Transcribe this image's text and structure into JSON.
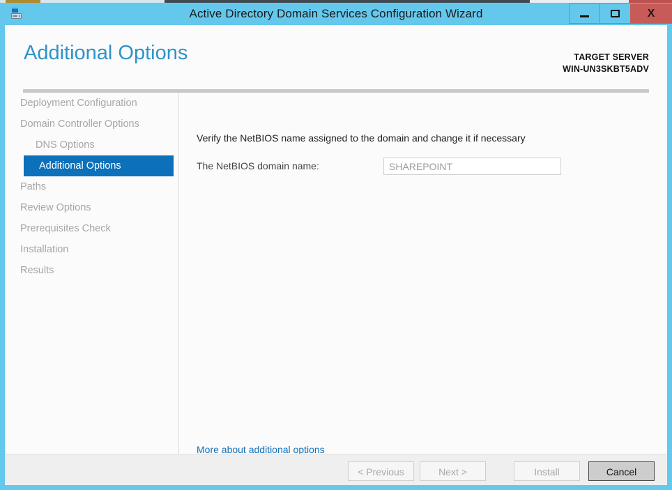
{
  "window": {
    "title": "Active Directory Domain Services Configuration Wizard",
    "icon": "server-configuration-icon",
    "controls": {
      "minimize": "—",
      "maximize": "□",
      "close": "X"
    },
    "accent_color": "#64c8ec",
    "close_color": "#c75b57"
  },
  "header": {
    "page_title": "Additional Options",
    "page_title_color": "#2e93c9",
    "target_server_label": "TARGET SERVER",
    "target_server_name": "WIN-UN3SKBT5ADV"
  },
  "navigation": {
    "active_color": "#0c70bb",
    "items": [
      {
        "label": "Deployment Configuration",
        "state": "completed",
        "indent": false
      },
      {
        "label": "Domain Controller Options",
        "state": "completed",
        "indent": false
      },
      {
        "label": "DNS Options",
        "state": "completed",
        "indent": true
      },
      {
        "label": "Additional Options",
        "state": "active",
        "indent": false
      },
      {
        "label": "Paths",
        "state": "pending",
        "indent": false
      },
      {
        "label": "Review Options",
        "state": "pending",
        "indent": false
      },
      {
        "label": "Prerequisites Check",
        "state": "pending",
        "indent": false
      },
      {
        "label": "Installation",
        "state": "pending",
        "indent": false
      },
      {
        "label": "Results",
        "state": "pending",
        "indent": false
      }
    ]
  },
  "content": {
    "instruction": "Verify the NetBIOS name assigned to the domain and change it if necessary",
    "netbios_label": "The NetBIOS domain name:",
    "netbios_value": "SHAREPOINT",
    "netbios_placeholder": "SHAREPOINT",
    "more_link": "More about additional options",
    "link_color": "#1570b8"
  },
  "footer": {
    "buttons": [
      {
        "label": "< Previous",
        "enabled": false
      },
      {
        "label": "Next >",
        "enabled": false
      },
      {
        "label": "Install",
        "enabled": false
      },
      {
        "label": "Cancel",
        "enabled": true
      }
    ]
  }
}
